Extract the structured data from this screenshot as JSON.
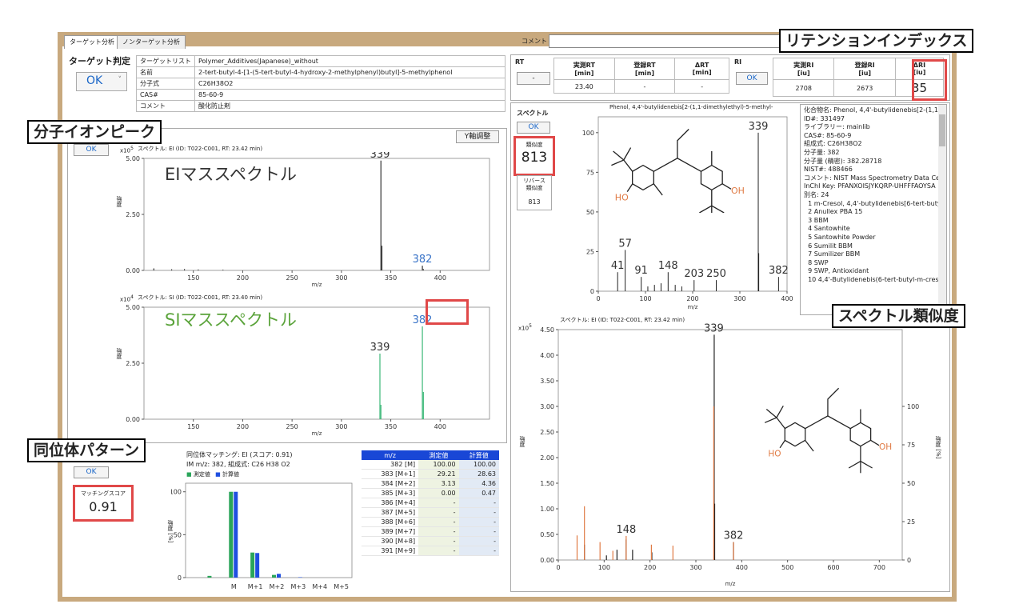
{
  "tabs": {
    "target": "ターゲット分析",
    "nontarget": "ノンターゲット分析",
    "comment_label": "コメント"
  },
  "callouts": {
    "retention_index": "リテンションインデックス",
    "molecular_ion": "分子イオンピーク",
    "isotope_pattern": "同位体パターン",
    "spectrum_similarity": "スペクトル類似度"
  },
  "target": {
    "judgement_label": "ターゲット判定",
    "judgement_value": "OK",
    "rows": [
      {
        "label": "ターゲットリスト",
        "value": "Polymer_Additives(Japanese)_without"
      },
      {
        "label": "名前",
        "value": "2-tert-butyl-4-[1-(5-tert-butyl-4-hydroxy-2-methylphenyl)butyl]-5-methylphenol"
      },
      {
        "label": "分子式",
        "value": "C26H38O2"
      },
      {
        "label": "CAS#",
        "value": "85-60-9"
      },
      {
        "label": "コメント",
        "value": "酸化防止剤"
      }
    ]
  },
  "rt": {
    "label": "RT",
    "status": "-",
    "headers": [
      "実測RT\n[min]",
      "登録RT\n[min]",
      "ΔRT\n[min]"
    ],
    "values": [
      "23.40",
      "-",
      "-"
    ]
  },
  "ri": {
    "label": "RI",
    "status": "OK",
    "headers": [
      "実測RI\n[iu]",
      "登録RI\n[iu]",
      "ΔRI\n[iu]"
    ],
    "values": [
      "2708",
      "2673",
      "35"
    ]
  },
  "ei_panel": {
    "ok": "OK",
    "y_adjust": "Y軸調整",
    "ei_title": "スペクトル: EI (ID: T022-C001, RT: 23.42 min)",
    "ei_big": "EIマススペクトル",
    "si_title": "スペクトル: SI (ID: T022-C001, RT: 23.40 min)",
    "si_big": "SIマススペクトル",
    "ylabel": "強度",
    "xlabel": "m/z",
    "ei_multiplier": "x10",
    "ei_exp": "5",
    "si_multiplier": "x10",
    "si_exp": "4"
  },
  "isotope": {
    "ok": "OK",
    "score_label": "マッチングスコア",
    "score_value": "0.91",
    "title1": "同位体マッチング: EI (スコア: 0.91)",
    "title2": "IM m/z: 382, 組成式: C26 H38 O2",
    "legend_measured": "測定値",
    "legend_calc": "計算値",
    "ylabel": "強度 [%]",
    "table_headers": [
      "m/z",
      "測定値",
      "計算値"
    ],
    "table_rows": [
      [
        "382 [M]",
        "100.00",
        "100.00"
      ],
      [
        "383 [M+1]",
        "29.21",
        "28.63"
      ],
      [
        "384 [M+2]",
        "3.13",
        "4.36"
      ],
      [
        "385 [M+3]",
        "0.00",
        "0.47"
      ],
      [
        "386 [M+4]",
        "-",
        "-"
      ],
      [
        "387 [M+5]",
        "-",
        "-"
      ],
      [
        "388 [M+6]",
        "-",
        "-"
      ],
      [
        "389 [M+7]",
        "-",
        "-"
      ],
      [
        "390 [M+8]",
        "-",
        "-"
      ],
      [
        "391 [M+9]",
        "-",
        "-"
      ]
    ]
  },
  "library": {
    "spectrum_label": "スペクトル",
    "ok": "OK",
    "similarity_label": "類似度",
    "similarity_value": "813",
    "reverse_label": "リバース\n類似度",
    "reverse_value": "813",
    "top_title": "Phenol, 4,4'-butylidenebis[2-(1,1-dimethylethyl)-5-methyl-",
    "bottom_title": "スペクトル: EI (ID: T022-C001, RT: 23.42 min)",
    "xlabel": "m/z",
    "ylabel_left": "強度",
    "ylabel_right": "強度 [%]",
    "bottom_multiplier": "x10",
    "bottom_exp": "5",
    "meta_lines": [
      "化合物名: Phenol, 4,4'-butylidenebis[2-(1,1-",
      "ID#: 331497",
      "ライブラリー: mainlib",
      "CAS#: 85-60-9",
      "組成式: C26H38O2",
      "分子量: 382",
      "分子量 (精密): 382.28718",
      "NIST#: 488466",
      "コメント: NIST Mass Spectrometry Data Cente",
      "InChI Key: PFANXOISJYKQRP-UHFFFAOYSA",
      "別名: 24",
      "  1 m-Cresol, 4,4'-butylidenebis[6-tert-buty",
      "  2 Anullex PBA 15",
      "  3 BBM",
      "  4 Santowhite",
      "  5 Santowhite Powder",
      "  6 Sumilit BBM",
      "  7 Sumilizer BBM",
      "  8 SWP",
      "  9 SWP, Antioxidant",
      "  10 4,4'-Butylidenebis(6-tert-butyl-m-cresc"
    ],
    "structure": {
      "ho": "HO",
      "oh": "OH"
    }
  },
  "colors": {
    "frame": "#c8a97e",
    "ei_peak": "#333333",
    "si_peak": "#3cb878",
    "measured": "#2aa55a",
    "calc": "#1f4fe0",
    "highlight": "#e04848",
    "lib_peak": "#222222",
    "lib_overlay": "#e07b45"
  },
  "chart_data": [
    {
      "type": "bar",
      "title": "スペクトル: EI (ID: T022-C001, RT: 23.42 min)",
      "xlabel": "m/z",
      "ylabel": "強度",
      "xlim": [
        100,
        450
      ],
      "ylim": [
        0,
        500000
      ],
      "xticks": [
        150,
        200,
        250,
        300,
        350,
        400
      ],
      "yticks": [
        "0.00",
        "2.50",
        "5.00"
      ],
      "peaks": [
        [
          110,
          9000
        ],
        [
          128,
          5000
        ],
        [
          141,
          6000
        ],
        [
          155,
          4000
        ],
        [
          180,
          3000
        ],
        [
          340,
          490000
        ],
        [
          341,
          110000
        ],
        [
          382,
          21000
        ],
        [
          383,
          6000
        ]
      ],
      "labels": [
        {
          "mz": 339,
          "text": "339"
        },
        {
          "mz": 382,
          "text": "382"
        }
      ]
    },
    {
      "type": "bar",
      "title": "スペクトル: SI (ID: T022-C001, RT: 23.40 min)",
      "xlabel": "m/z",
      "ylabel": "強度",
      "xlim": [
        100,
        450
      ],
      "ylim": [
        0,
        70000
      ],
      "xticks": [
        150,
        200,
        250,
        300,
        350,
        400
      ],
      "yticks": [
        "0.00",
        "2.50",
        "5.00"
      ],
      "peaks": [
        [
          339,
          41000
        ],
        [
          340,
          9000
        ],
        [
          382,
          58000
        ],
        [
          383,
          17000
        ]
      ],
      "labels": [
        {
          "mz": 339,
          "text": "339"
        },
        {
          "mz": 382,
          "text": "382"
        }
      ]
    },
    {
      "type": "bar",
      "title": "同位体マッチング: EI (スコア: 0.91)",
      "categories": [
        "",
        "M",
        "M+1",
        "M+2",
        "M+3",
        "M+4",
        "M+5"
      ],
      "ylabel": "強度 [%]",
      "ylim": [
        0,
        110
      ],
      "yticks": [
        0,
        50,
        100
      ],
      "series": [
        {
          "name": "測定値",
          "values": [
            2,
            100,
            29.21,
            3.13,
            0,
            0,
            0
          ]
        },
        {
          "name": "計算値",
          "values": [
            0,
            100,
            28.63,
            4.36,
            0.47,
            0,
            0
          ]
        }
      ]
    },
    {
      "type": "bar",
      "title": "Phenol, 4,4'-butylidenebis[2-(1,1-dimethylethyl)-5-methyl-",
      "xlabel": "m/z",
      "ylim": [
        0,
        110
      ],
      "xlim": [
        0,
        400
      ],
      "xticks": [
        0,
        100,
        200,
        300,
        400
      ],
      "yticks": [
        0,
        25,
        50,
        75,
        100
      ],
      "peaks": [
        [
          41,
          12
        ],
        [
          57,
          26
        ],
        [
          91,
          9
        ],
        [
          105,
          3
        ],
        [
          119,
          4
        ],
        [
          133,
          5
        ],
        [
          148,
          12
        ],
        [
          163,
          4
        ],
        [
          177,
          3
        ],
        [
          203,
          7
        ],
        [
          250,
          7
        ],
        [
          339,
          100
        ],
        [
          340,
          24
        ],
        [
          382,
          9
        ]
      ],
      "labels": [
        {
          "mz": 41,
          "text": "41"
        },
        {
          "mz": 57,
          "text": "57"
        },
        {
          "mz": 91,
          "text": "91"
        },
        {
          "mz": 148,
          "text": "148"
        },
        {
          "mz": 203,
          "text": "203"
        },
        {
          "mz": 250,
          "text": "250"
        },
        {
          "mz": 339,
          "text": "339"
        },
        {
          "mz": 382,
          "text": "382"
        }
      ]
    },
    {
      "type": "bar",
      "title": "スペクトル: EI (ID: T022-C001, RT: 23.42 min)",
      "xlabel": "m/z",
      "ylabel": "強度",
      "xlim": [
        0,
        750
      ],
      "ylim": [
        0,
        450000
      ],
      "xticks": [
        0,
        100,
        200,
        300,
        400,
        500,
        600,
        700
      ],
      "yticks": [
        "0.00",
        "0.50",
        "1.00",
        "1.50",
        "2.00",
        "2.50",
        "3.00",
        "3.50",
        "4.00",
        "4.50"
      ],
      "y2ticks": [
        0,
        25,
        50,
        75,
        100
      ],
      "series": [
        {
          "name": "",
          "peaks": [
            [
              57,
              30000
            ],
            [
              105,
              9000
            ],
            [
              128,
              20000
            ],
            [
              148,
              40000
            ],
            [
              162,
              20000
            ],
            [
              204,
              15000
            ],
            [
              340,
              440000
            ],
            [
              341,
              110000
            ],
            [
              382,
              35000
            ]
          ]
        },
        {
          "name": "",
          "peaks": [
            [
              41,
              48000
            ],
            [
              57,
              105000
            ],
            [
              91,
              35000
            ],
            [
              119,
              18000
            ],
            [
              148,
              47000
            ],
            [
              203,
              30000
            ],
            [
              250,
              28000
            ],
            [
              339,
              300000
            ],
            [
              382,
              35000
            ]
          ]
        }
      ],
      "labels": [
        {
          "mz": 148,
          "text": "148"
        },
        {
          "mz": 339,
          "text": "339"
        },
        {
          "mz": 382,
          "text": "382"
        }
      ]
    }
  ]
}
